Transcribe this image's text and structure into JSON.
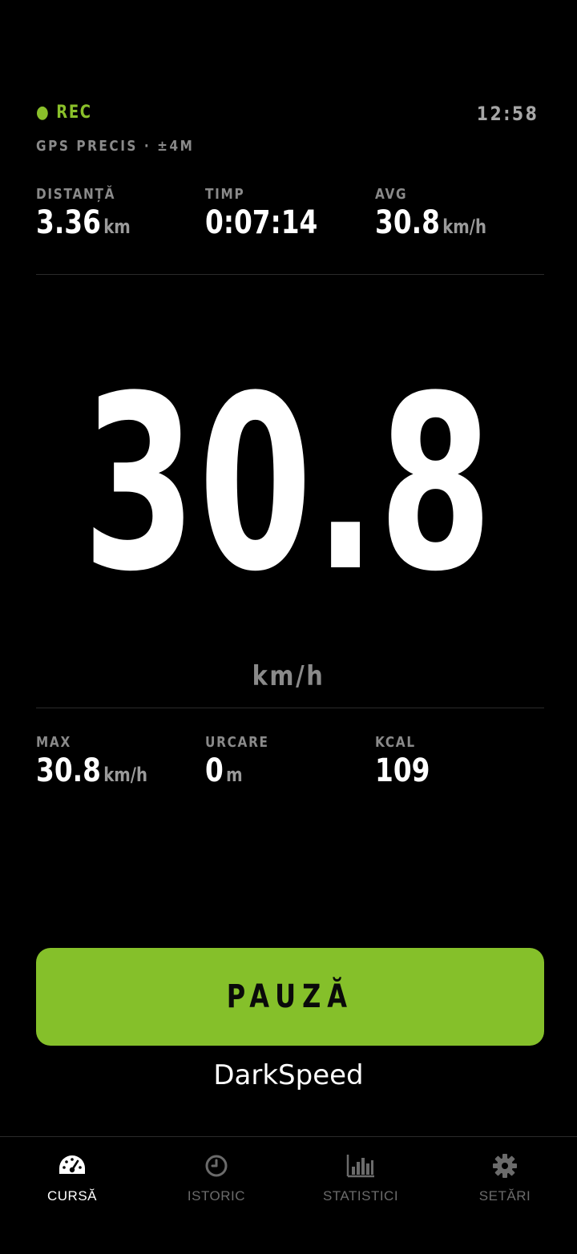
{
  "header": {
    "rec_label": "● REC",
    "clock": "12:58",
    "gps_status": "GPS PRECIS · ±4M"
  },
  "top_stats": [
    {
      "label": "DISTANȚĂ",
      "value": "3.36",
      "unit": "km"
    },
    {
      "label": "TIMP",
      "value": "0:07:14",
      "unit": ""
    },
    {
      "label": "AVG",
      "value": "30.8",
      "unit": "km/h"
    }
  ],
  "speed": {
    "value": "30.8",
    "unit": "km/h"
  },
  "bottom_stats": [
    {
      "label": "MAX",
      "value": "30.8",
      "unit": "km/h"
    },
    {
      "label": "URCARE",
      "value": "0",
      "unit": "m"
    },
    {
      "label": "KCAL",
      "value": "109",
      "unit": ""
    }
  ],
  "pause_button": {
    "label": "PAUZĂ"
  },
  "brand": "DarkSpeed",
  "nav": {
    "items": [
      {
        "label": "CURSĂ",
        "icon": "speedometer-icon",
        "active": true
      },
      {
        "label": "ISTORIC",
        "icon": "clock-icon",
        "active": false
      },
      {
        "label": "STATISTICI",
        "icon": "bar-chart-icon",
        "active": false
      },
      {
        "label": "SETĂRI",
        "icon": "gear-icon",
        "active": false
      }
    ]
  },
  "colors": {
    "accent": "#85c02a",
    "rec": "#8ac02a",
    "muted": "#8a8a8a",
    "nav_inactive": "#6b6b6b",
    "nav_active": "#ffffff"
  }
}
